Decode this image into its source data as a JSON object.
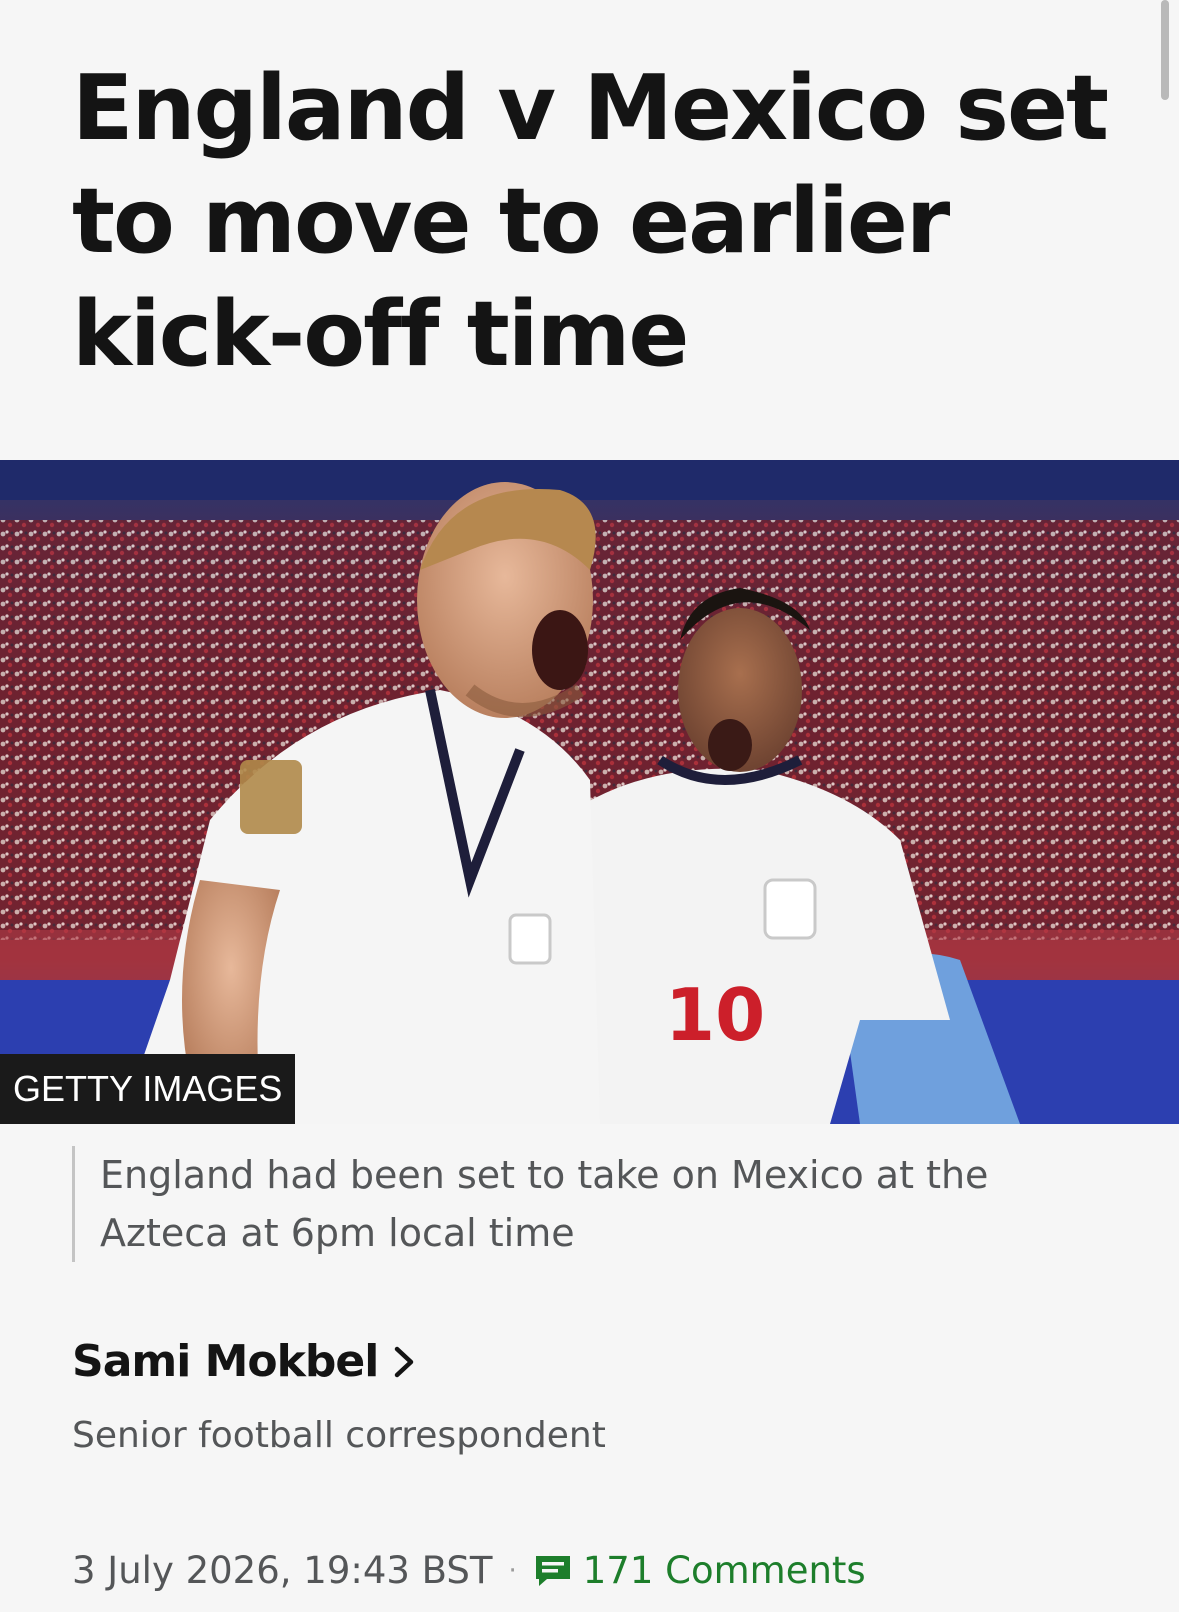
{
  "article": {
    "headline": "England v Mexico set to move to earlier kick-off time",
    "image": {
      "credit": "GETTY IMAGES",
      "shirt_number": "10"
    },
    "caption": "England had been set to take on Mexico at the Azteca at 6pm local time",
    "author": {
      "name": "Sami Mokbel",
      "role": "Senior football correspondent"
    },
    "meta": {
      "timestamp": "3 July 2026, 19:43 BST",
      "separator": "·",
      "comments_label": "171 Comments"
    }
  },
  "icons": {
    "author_link": "chevron-right-icon",
    "comments": "comment-icon"
  },
  "colors": {
    "background": "#f6f6f6",
    "headline": "#141414",
    "secondary_text": "#545658",
    "comments_accent": "#1d7e2b",
    "credit_background": "#1a1a1a"
  }
}
